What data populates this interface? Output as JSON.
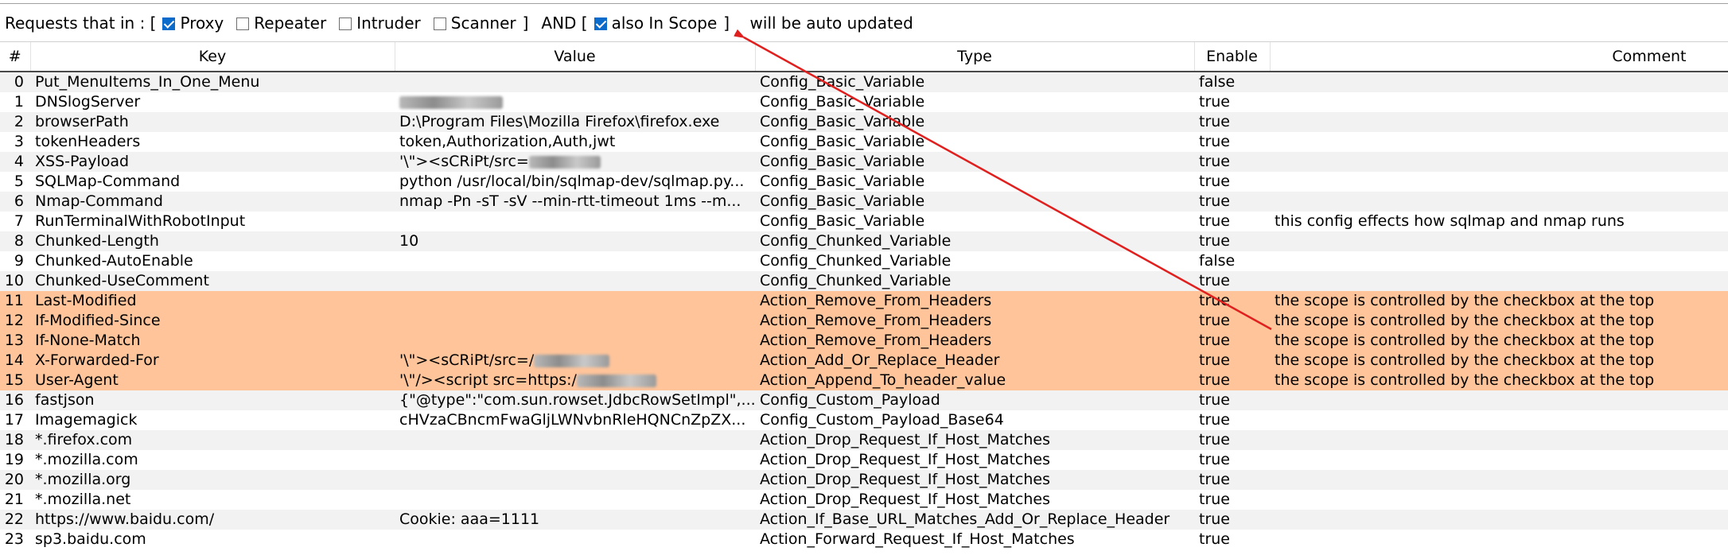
{
  "filter": {
    "prefix": "Requests that in : [",
    "options": [
      {
        "label": "Proxy",
        "checked": true
      },
      {
        "label": "Repeater",
        "checked": false
      },
      {
        "label": "Intruder",
        "checked": false
      },
      {
        "label": "Scanner",
        "checked": false
      }
    ],
    "close_bracket": "]",
    "and_text": "AND [",
    "scope_label": "also In Scope",
    "scope_checked": true,
    "suffix": "]    will be auto updated"
  },
  "table": {
    "headers": [
      "#",
      "Key",
      "Value",
      "Type",
      "Enable",
      "Comment"
    ],
    "rows": [
      {
        "num": "0",
        "key": "Put_MenuItems_In_One_Menu",
        "value": "",
        "type": "Config_Basic_Variable",
        "enable": "false",
        "comment": "",
        "hl": false
      },
      {
        "num": "1",
        "key": "DNSlogServer",
        "value": "",
        "type": "Config_Basic_Variable",
        "enable": "true",
        "comment": "",
        "hl": false
      },
      {
        "num": "2",
        "key": "browserPath",
        "value": "D:\\Program Files\\Mozilla Firefox\\firefox.exe",
        "type": "Config_Basic_Variable",
        "enable": "true",
        "comment": "",
        "hl": false
      },
      {
        "num": "3",
        "key": "tokenHeaders",
        "value": "token,Authorization,Auth,jwt",
        "type": "Config_Basic_Variable",
        "enable": "true",
        "comment": "",
        "hl": false
      },
      {
        "num": "4",
        "key": "XSS-Payload",
        "value": "'\\\"><sCRiPt/src=",
        "type": "Config_Basic_Variable",
        "enable": "true",
        "comment": "",
        "hl": false
      },
      {
        "num": "5",
        "key": "SQLMap-Command",
        "value": "python /usr/local/bin/sqlmap-dev/sqlmap.py...",
        "type": "Config_Basic_Variable",
        "enable": "true",
        "comment": "",
        "hl": false
      },
      {
        "num": "6",
        "key": "Nmap-Command",
        "value": "nmap -Pn -sT -sV --min-rtt-timeout 1ms --m...",
        "type": "Config_Basic_Variable",
        "enable": "true",
        "comment": "",
        "hl": false
      },
      {
        "num": "7",
        "key": "RunTerminalWithRobotInput",
        "value": "",
        "type": "Config_Basic_Variable",
        "enable": "true",
        "comment": "this config effects how sqlmap and nmap runs",
        "hl": false
      },
      {
        "num": "8",
        "key": "Chunked-Length",
        "value": "10",
        "type": "Config_Chunked_Variable",
        "enable": "true",
        "comment": "",
        "hl": false
      },
      {
        "num": "9",
        "key": "Chunked-AutoEnable",
        "value": "",
        "type": "Config_Chunked_Variable",
        "enable": "false",
        "comment": "",
        "hl": false
      },
      {
        "num": "10",
        "key": "Chunked-UseComment",
        "value": "",
        "type": "Config_Chunked_Variable",
        "enable": "true",
        "comment": "",
        "hl": false
      },
      {
        "num": "11",
        "key": "Last-Modified",
        "value": "",
        "type": "Action_Remove_From_Headers",
        "enable": "true",
        "comment": "the scope is controlled by the checkbox at the top",
        "hl": true
      },
      {
        "num": "12",
        "key": "If-Modified-Since",
        "value": "",
        "type": "Action_Remove_From_Headers",
        "enable": "true",
        "comment": "the scope is controlled by the checkbox at the top",
        "hl": true
      },
      {
        "num": "13",
        "key": "If-None-Match",
        "value": "",
        "type": "Action_Remove_From_Headers",
        "enable": "true",
        "comment": "the scope is controlled by the checkbox at the top",
        "hl": true
      },
      {
        "num": "14",
        "key": "X-Forwarded-For",
        "value": "'\\\"><sCRiPt/src=/",
        "type": "Action_Add_Or_Replace_Header",
        "enable": "true",
        "comment": "the scope is controlled by the checkbox at the top",
        "hl": true
      },
      {
        "num": "15",
        "key": "User-Agent",
        "value": "'\\\"/><script src=https:/",
        "type": "Action_Append_To_header_value",
        "enable": "true",
        "comment": "the scope is controlled by the checkbox at the top",
        "hl": true
      },
      {
        "num": "16",
        "key": "fastjson",
        "value": "{\"@type\":\"com.sun.rowset.JdbcRowSetImpl\",...",
        "type": "Config_Custom_Payload",
        "enable": "true",
        "comment": "",
        "hl": false
      },
      {
        "num": "17",
        "key": "Imagemagick",
        "value": "cHVzaCBncmFwaGljLWNvbnRleHQNCnZpZX...",
        "type": "Config_Custom_Payload_Base64",
        "enable": "true",
        "comment": "",
        "hl": false
      },
      {
        "num": "18",
        "key": "*.firefox.com",
        "value": "",
        "type": "Action_Drop_Request_If_Host_Matches",
        "enable": "true",
        "comment": "",
        "hl": false
      },
      {
        "num": "19",
        "key": "*.mozilla.com",
        "value": "",
        "type": "Action_Drop_Request_If_Host_Matches",
        "enable": "true",
        "comment": "",
        "hl": false
      },
      {
        "num": "20",
        "key": "*.mozilla.org",
        "value": "",
        "type": "Action_Drop_Request_If_Host_Matches",
        "enable": "true",
        "comment": "",
        "hl": false
      },
      {
        "num": "21",
        "key": "*.mozilla.net",
        "value": "",
        "type": "Action_Drop_Request_If_Host_Matches",
        "enable": "true",
        "comment": "",
        "hl": false
      },
      {
        "num": "22",
        "key": "https://www.baidu.com/",
        "value": "Cookie: aaa=1111",
        "type": "Action_If_Base_URL_Matches_Add_Or_Replace_Header",
        "enable": "true",
        "comment": "",
        "hl": false
      },
      {
        "num": "23",
        "key": "sp3.baidu.com",
        "value": "",
        "type": "Action_Forward_Request_If_Host_Matches",
        "enable": "true",
        "comment": "",
        "hl": false
      }
    ]
  },
  "colors": {
    "highlight_row": "#ffc49a",
    "annotation_arrow": "#e0201e",
    "checkbox_checked": "#0b6bcb"
  }
}
